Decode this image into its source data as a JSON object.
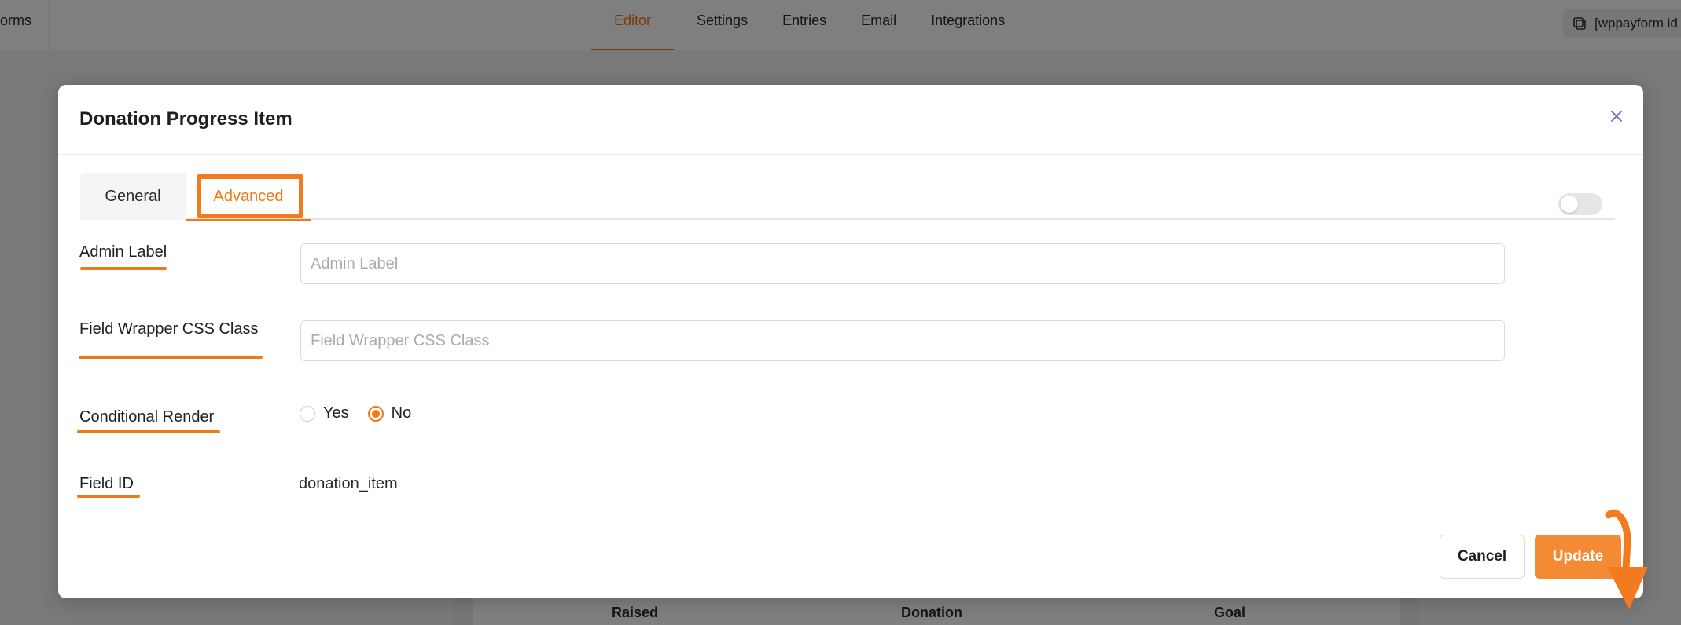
{
  "topbar": {
    "left_title": "orms",
    "tabs": [
      "Editor",
      "Settings",
      "Entries",
      "Email",
      "Integrations"
    ],
    "shortcode": "[wppayform id"
  },
  "background_table": {
    "headers": [
      "Raised",
      "Donation",
      "Goal"
    ]
  },
  "modal": {
    "title": "Donation Progress Item",
    "tabs": {
      "general": "General",
      "advanced": "Advanced"
    },
    "fields": {
      "admin_label": {
        "label": "Admin Label",
        "placeholder": "Admin Label",
        "value": ""
      },
      "wrapper_css": {
        "label": "Field Wrapper CSS Class",
        "placeholder": "Field Wrapper CSS Class",
        "value": ""
      },
      "conditional_render": {
        "label": "Conditional Render",
        "options": [
          "Yes",
          "No"
        ],
        "selected": "No"
      },
      "field_id": {
        "label": "Field ID",
        "value": "donation_item"
      }
    },
    "buttons": {
      "cancel": "Cancel",
      "update": "Update"
    }
  },
  "colors": {
    "accent": "#f07b16",
    "close": "#6a5bd6"
  }
}
